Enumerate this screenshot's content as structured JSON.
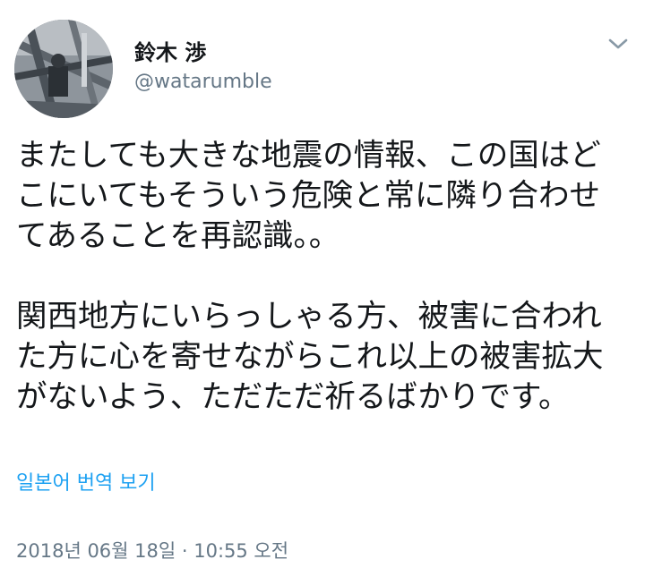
{
  "tweet": {
    "author": {
      "display_name": "鈴木 渉",
      "handle": "@watarumble"
    },
    "menu_icon": "chevron-down-icon",
    "text_lines": [
      "またしても大きな地震の情報、この国はど",
      "こにいてもそういう危険と常に隣り合わせ",
      "てあることを再認識。。",
      "",
      "関西地方にいらっしゃる方、被害に合われ",
      "た方に心を寄せながらこれ以上の被害拡大",
      "がないよう、ただただ祈るばかりです。"
    ],
    "translate_label": "일본어 번역 보기",
    "timestamp": "2018년 06월 18일 · 10:55 오전"
  },
  "colors": {
    "text": "#14171a",
    "secondary": "#657786",
    "link": "#1da1f2"
  }
}
